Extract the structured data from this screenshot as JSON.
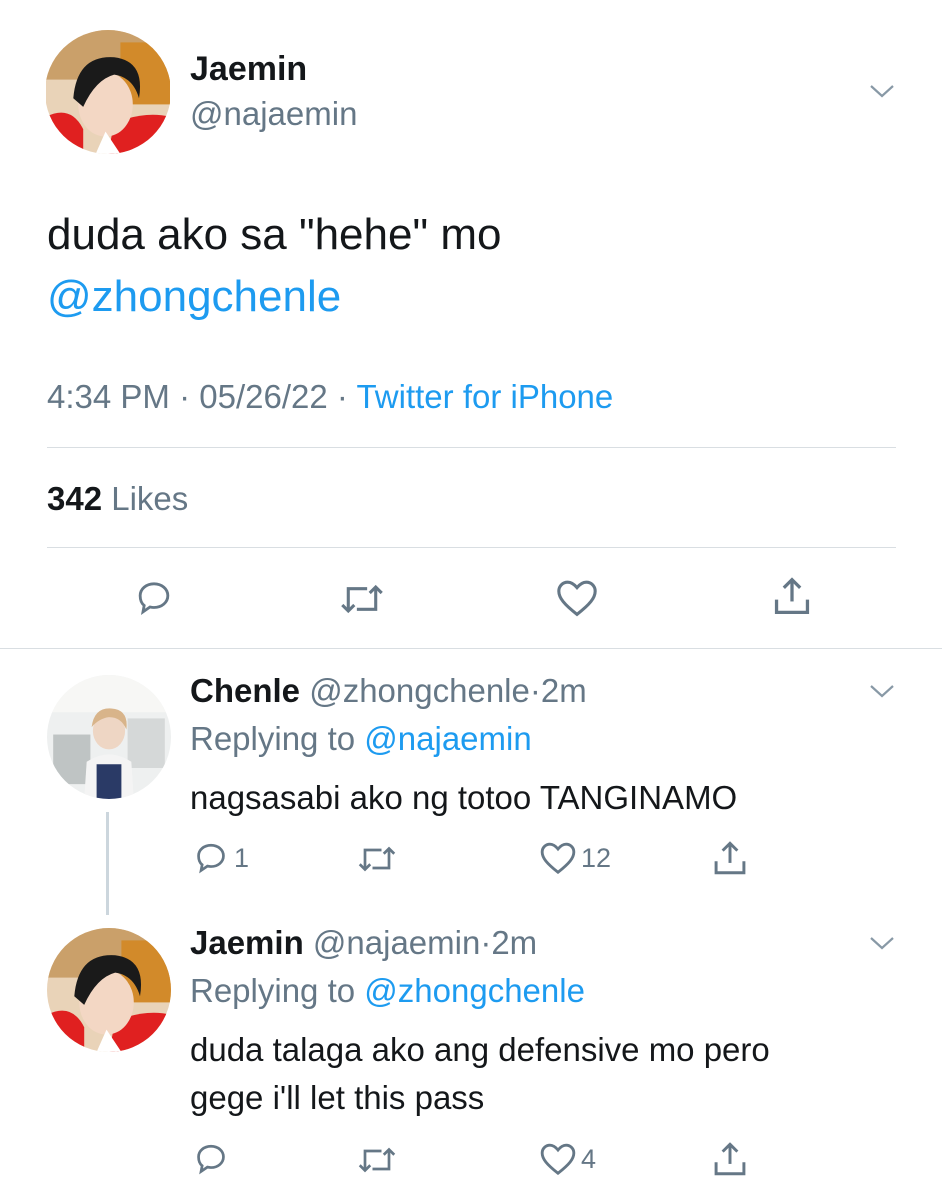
{
  "main_tweet": {
    "author_name": "Jaemin",
    "author_handle": "@najaemin",
    "text": "duda ako sa \"hehe\" mo",
    "mention": "@zhongchenle",
    "time": "4:34 PM",
    "separator": "·",
    "date": "05/26/22",
    "client": "Twitter for iPhone",
    "likes_count": "342",
    "likes_label": "Likes"
  },
  "replies": [
    {
      "author_name": "Chenle",
      "author_handle": "@zhongchenle",
      "separator": "·",
      "time_ago": "2m",
      "replying_prefix": "Replying to",
      "replying_to": "@najaemin",
      "text_lines": [
        "nagsasabi ako ng totoo TANGINAMO"
      ],
      "reply_count": "1",
      "retweet_count": "",
      "like_count": "12"
    },
    {
      "author_name": "Jaemin",
      "author_handle": "@najaemin",
      "separator": "·",
      "time_ago": "2m",
      "replying_prefix": "Replying to",
      "replying_to": "@zhongchenle",
      "text_lines": [
        "duda talaga ako ang defensive mo pero",
        "gege i'll let this pass"
      ],
      "reply_count": "",
      "retweet_count": "",
      "like_count": "4"
    }
  ],
  "icons": {
    "more": "chevron-down-icon",
    "reply": "reply-bubble-icon",
    "retweet": "retweet-icon",
    "like": "heart-icon",
    "share": "share-icon"
  },
  "colors": {
    "text": "#14171a",
    "secondary": "#657786",
    "link": "#1d9bf0",
    "divider": "#d9dee2",
    "thread_line": "#ccd6dd"
  }
}
